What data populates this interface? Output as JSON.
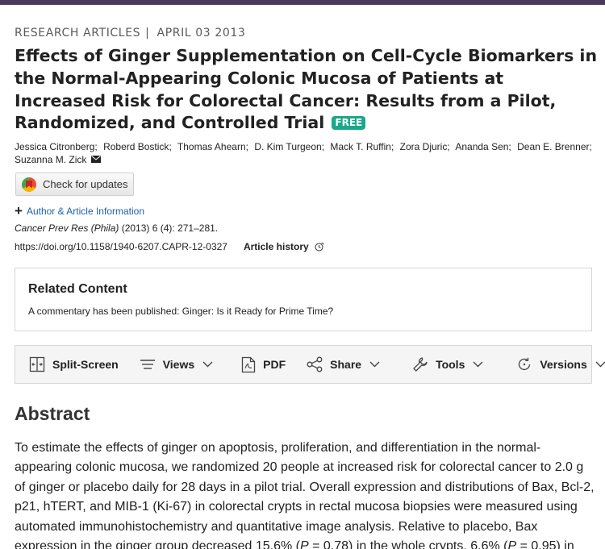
{
  "header": {
    "section": "RESEARCH ARTICLES",
    "separator": "|",
    "date": "APRIL 03 2013"
  },
  "article": {
    "title": "Effects of Ginger Supplementation on Cell-Cycle Biomarkers in the Normal-Appearing Colonic Mucosa of Patients at Increased Risk for Colorectal Cancer: Results from a Pilot, Randomized, and Controlled Trial",
    "badge": "FREE",
    "authors": [
      "Jessica Citronberg",
      "Roberd Bostick",
      "Thomas Ahearn",
      "D. Kim Turgeon",
      "Mack T. Ruffin",
      "Zora Djuric",
      "Ananda Sen",
      "Dean E. Brenner",
      "Suzanna M. Zick"
    ],
    "check_updates_label": "Check for updates",
    "author_info_label": "Author & Article Information",
    "citation": {
      "journal": "Cancer Prev Res (Phila)",
      "details": " (2013) 6 (4): 271–281."
    },
    "doi": "https://doi.org/10.1158/1940-6207.CAPR-12-0327",
    "history_label": "Article history"
  },
  "related": {
    "heading": "Related Content",
    "text": "A commentary has been published: Ginger: Is it Ready for Prime Time?"
  },
  "toolbar": {
    "split_screen": "Split-Screen",
    "views": "Views",
    "pdf": "PDF",
    "share": "Share",
    "tools": "Tools",
    "versions": "Versions"
  },
  "abstract": {
    "heading": "Abstract",
    "text_before": "To estimate the effects of ginger on apoptosis, proliferation, and differentiation in the normal-appearing colonic mucosa, we randomized 20 people at increased risk for colorectal cancer to 2.0 g of ginger or placebo daily for 28 days in a pilot trial. Overall expression and distributions of Bax, Bcl-2, p21, hTERT, and MIB-1 (Ki-67) in colorectal crypts in rectal mucosa biopsies were measured using automated immunohistochemistry and quantitative image analysis. Relative to placebo, Bax expression in the ginger group decreased 15.6% (",
    "p1_italic": "P",
    "p1_rest": " = 0.78) in the whole crypts, 6.6% (",
    "p2_italic": "P",
    "p2_rest": " = 0.95) in"
  },
  "colors": {
    "topbar": "#4b3a5e",
    "badge": "#1aa88a",
    "link": "#1f5fa8"
  }
}
